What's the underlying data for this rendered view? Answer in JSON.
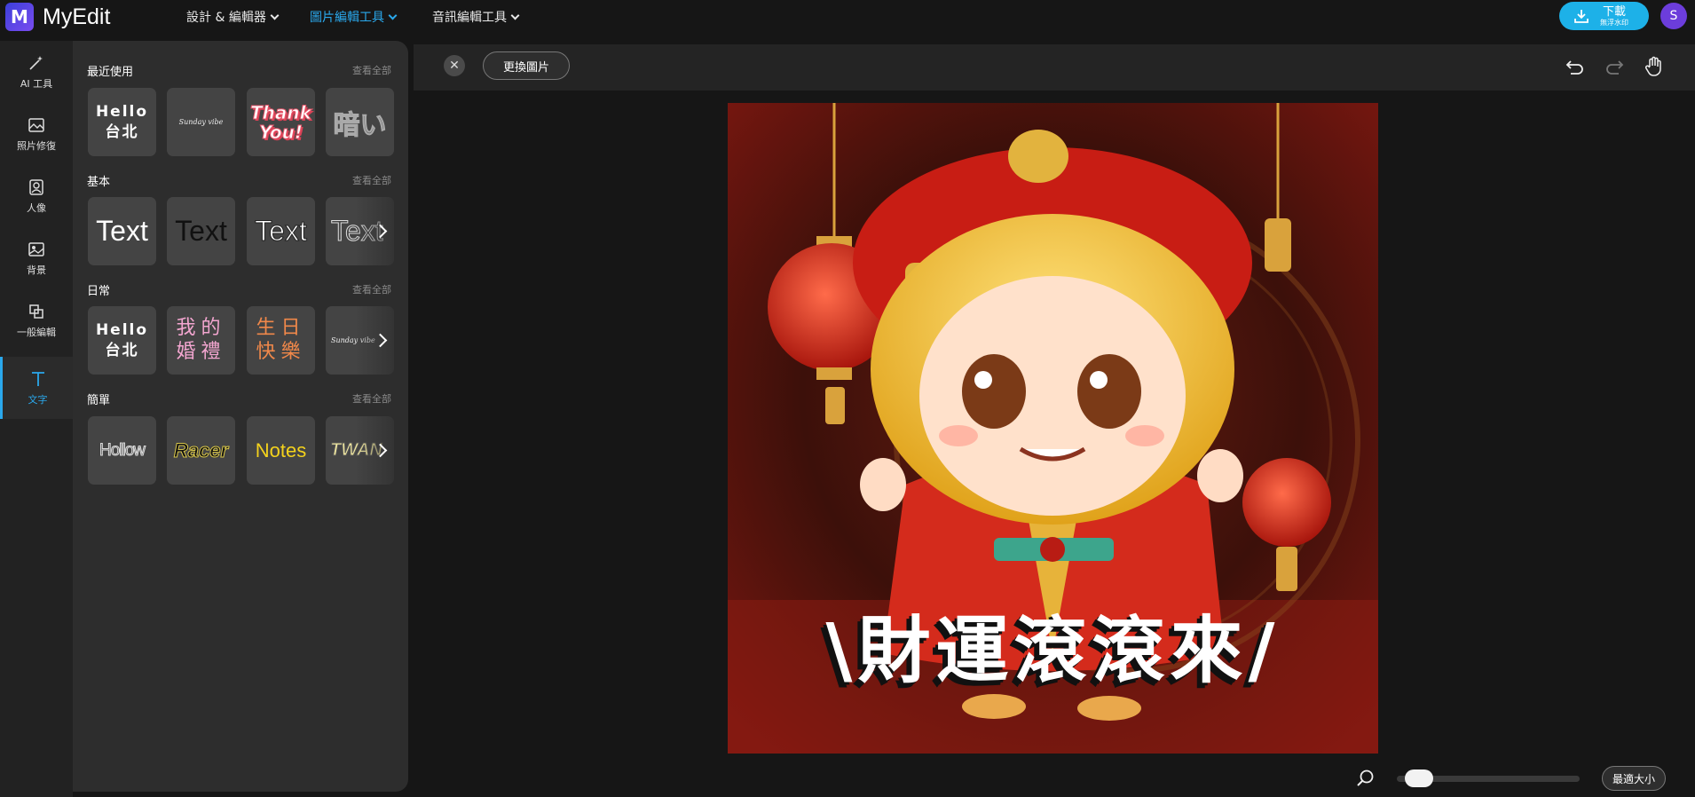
{
  "app": {
    "name": "MyEdit",
    "logo_letter": "M"
  },
  "nav": [
    {
      "label": "設計 & 編輯器",
      "active": false
    },
    {
      "label": "圖片編輯工具",
      "active": true
    },
    {
      "label": "音訊編輯工具",
      "active": false
    }
  ],
  "download": {
    "label": "下載",
    "sub": "無浮水印"
  },
  "user": {
    "initial": "S"
  },
  "rail": [
    {
      "label": "AI 工具",
      "icon": "magic-wand-icon"
    },
    {
      "label": "照片修復",
      "icon": "photo-repair-icon"
    },
    {
      "label": "人像",
      "icon": "portrait-icon"
    },
    {
      "label": "背景",
      "icon": "background-icon"
    },
    {
      "label": "一般編輯",
      "icon": "crop-icon"
    },
    {
      "label": "文字",
      "icon": "text-icon",
      "active": true
    }
  ],
  "panel": {
    "view_all": "查看全部",
    "sections": [
      {
        "title": "最近使用",
        "tiles": [
          "Hello\n台北",
          "Sunday vibe",
          "Thank\nYou!",
          "暗い"
        ]
      },
      {
        "title": "基本",
        "tiles": [
          "Text",
          "Text",
          "Text",
          "Text"
        ]
      },
      {
        "title": "日常",
        "tiles": [
          "Hello\n台北",
          "我的\n婚禮",
          "生日\n快樂",
          "Sunday vibe"
        ]
      },
      {
        "title": "簡單",
        "tiles": [
          "Hollow",
          "Racer",
          "Notes",
          "TWAN"
        ]
      }
    ]
  },
  "canvas": {
    "replace_label": "更換圖片",
    "caption": "\\財運滾滾來/",
    "fit_label": "最適大小",
    "zoom_level": 0.05
  },
  "colors": {
    "accent": "#2aa8ec",
    "download": "#1db1e8",
    "avatar": "#6c3ddb"
  }
}
